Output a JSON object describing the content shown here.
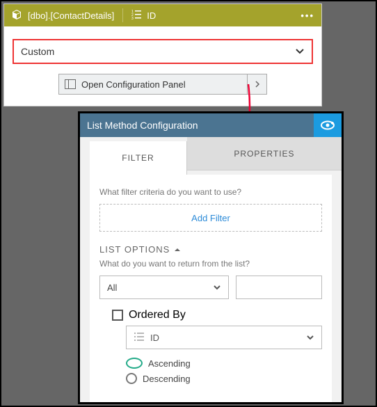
{
  "header": {
    "table_name": "[dbo].[ContactDetails]",
    "field_label": "ID"
  },
  "custom_select": {
    "value": "Custom"
  },
  "open_config_button": {
    "label": "Open Configuration Panel"
  },
  "modal": {
    "title": "List Method Configuration",
    "tabs": {
      "filter": "FILTER",
      "properties": "PROPERTIES"
    },
    "filter_question": "What filter criteria do you want to use?",
    "add_filter": "Add Filter",
    "list_options_label": "LIST OPTIONS",
    "return_question": "What do you want to return from the list?",
    "return_select": "All",
    "ordered_by_label": "Ordered By",
    "order_field": "ID",
    "ascending": "Ascending",
    "descending": "Descending"
  }
}
